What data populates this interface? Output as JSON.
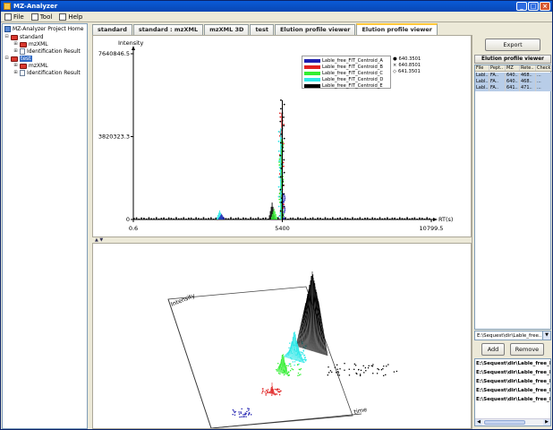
{
  "window": {
    "title": "MZ-Analyzer",
    "controls": [
      "_",
      "□",
      "×"
    ]
  },
  "menu": {
    "items": [
      {
        "label": "File",
        "icon": "file-icon"
      },
      {
        "label": "Tool",
        "icon": "tool-icon"
      },
      {
        "label": "Help",
        "icon": "help-icon"
      }
    ]
  },
  "tree": {
    "root": "MZ-Analyzer Project Home",
    "nodes": [
      {
        "label": "standard",
        "depth": 1
      },
      {
        "label": "mzXML",
        "depth": 2
      },
      {
        "label": "Identification Result",
        "depth": 2
      },
      {
        "label": "test",
        "depth": 1
      },
      {
        "label": "mzXML",
        "depth": 2
      },
      {
        "label": "Identification Result",
        "depth": 2
      }
    ]
  },
  "tabs": [
    {
      "label": "standard",
      "active": false
    },
    {
      "label": "standard : mzXML",
      "active": false
    },
    {
      "label": "mzXML 3D",
      "active": false
    },
    {
      "label": "test",
      "active": false
    },
    {
      "label": "Elution profile viewer",
      "active": false
    },
    {
      "label": "Elution profile viewer",
      "active": true
    }
  ],
  "chart_data": [
    {
      "type": "line",
      "ylabel": "Intensity",
      "xlabel": "RT(s)",
      "ylim": [
        0,
        7640846.5
      ],
      "xlim": [
        0.6,
        10799.5
      ],
      "yticks": [
        "7640846.5",
        "3820323.3",
        "0"
      ],
      "xticks": [
        "0.6",
        "5400",
        "10799.5"
      ],
      "legend": {
        "position": "top-right",
        "entries": [
          {
            "name": "Lable_free_FIT_Centroid_A",
            "color": "#1f1fb0"
          },
          {
            "name": "Lable_free_FIT_Centroid_B",
            "color": "#e02020"
          },
          {
            "name": "Lable_free_FIT_Centroid_C",
            "color": "#33ee33"
          },
          {
            "name": "Lable_free_FIT_Centroid_D",
            "color": "#30e8e8"
          },
          {
            "name": "Lable_free_FIT_Centroid_E",
            "color": "#000000"
          }
        ]
      },
      "mz_markers": [
        {
          "symbol": "●",
          "label": "640.3501"
        },
        {
          "symbol": "×",
          "label": "640.8501"
        },
        {
          "symbol": "◇",
          "label": "641.3501"
        }
      ],
      "series": [
        {
          "name": "Lable_free_FIT_Centroid_A",
          "peak_x": 5420,
          "peak_y": 1200000
        },
        {
          "name": "Lable_free_FIT_Centroid_B",
          "peak_x": 5380,
          "peak_y": 4900000
        },
        {
          "name": "Lable_free_FIT_Centroid_C",
          "peak_x": 5360,
          "peak_y": 3700000
        },
        {
          "name": "Lable_free_FIT_Centroid_D",
          "peak_x": 5340,
          "peak_y": 4200000
        },
        {
          "name": "Lable_free_FIT_Centroid_E",
          "peak_x": 5400,
          "peak_y": 5500000
        }
      ],
      "minor_peaks": [
        {
          "x": 3130,
          "y": 420000,
          "color": "#30e8e8"
        },
        {
          "x": 3200,
          "y": 260000,
          "color": "#1f1fb0"
        },
        {
          "x": 5030,
          "y": 780000,
          "color": "#000000"
        },
        {
          "x": 5100,
          "y": 500000,
          "color": "#33ee33"
        }
      ]
    },
    {
      "type": "scatter",
      "projection": "3D",
      "ylabel": "Intensity",
      "xlabel": "time"
    }
  ],
  "right_panel": {
    "export_label": "Export",
    "header": "Elution profile viewer",
    "columns": [
      "File",
      "Pept..",
      "MZ",
      "Rete..",
      "Check"
    ],
    "rows": [
      [
        "Labl..",
        "FA..",
        "640..",
        "468..",
        "..."
      ],
      [
        "Labl..",
        "FA..",
        "640..",
        "468..",
        "..."
      ],
      [
        "Labl..",
        "FA..",
        "641..",
        "471..",
        "..."
      ]
    ],
    "combo_value": "E:\\Sequest\\dir\\Lable_free...",
    "combo_arrow": "▼",
    "add_label": "Add",
    "remove_label": "Remove",
    "files": [
      "E:\\Sequest\\dir\\Lable_free_FIT_C",
      "E:\\Sequest\\dir\\Lable_free_FIT_C",
      "E:\\Sequest\\dir\\Lable_free_FIT_C",
      "E:\\Sequest\\dir\\Lable_free_FIT_C",
      "E:\\Sequest\\dir\\Lable_free_FIT_C"
    ]
  },
  "splitter_arrows": "▲ ▼"
}
